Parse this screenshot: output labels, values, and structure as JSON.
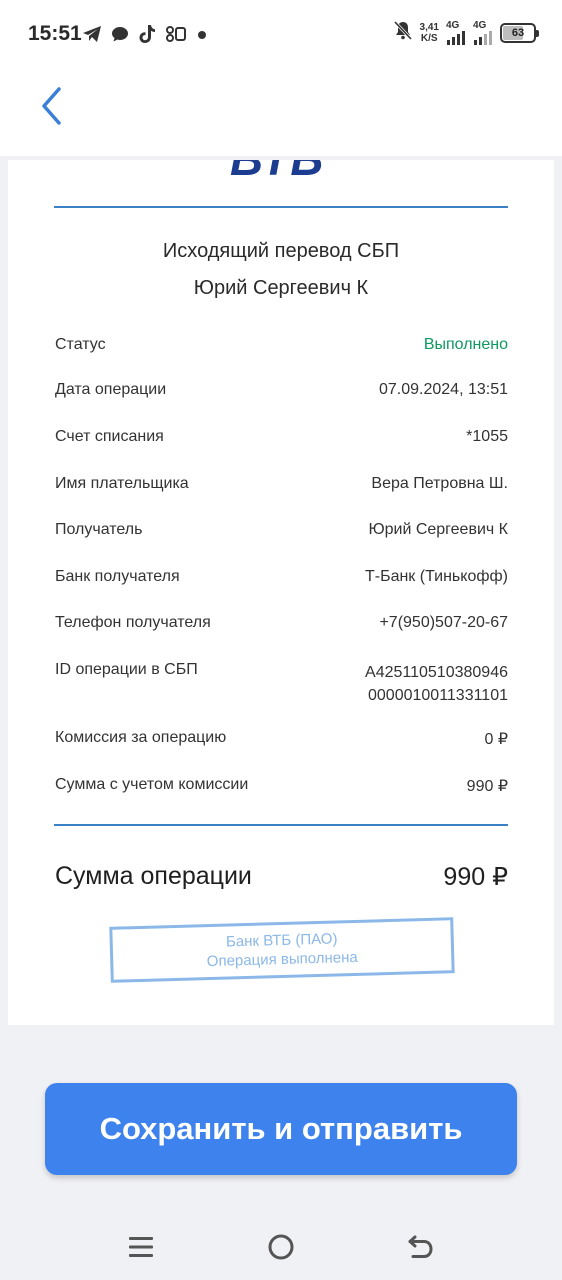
{
  "status_bar": {
    "time": "15:51",
    "speed_value": "3,41",
    "speed_unit": "K/S",
    "net1": "4G",
    "net2": "4G",
    "battery": "63"
  },
  "header": {
    "back_icon": "chevron-left-icon"
  },
  "receipt": {
    "bank_logo": "ВТБ",
    "title": "Исходящий перевод СБП",
    "recipient_name": "Юрий Сергеевич К",
    "rows": [
      {
        "label": "Статус",
        "value": "Выполнено"
      },
      {
        "label": "Дата операции",
        "value": "07.09.2024, 13:51"
      },
      {
        "label": "Счет списания",
        "value": "*1055"
      },
      {
        "label": "Имя плательщика",
        "value": "Вера Петровна Ш."
      },
      {
        "label": "Получатель",
        "value": "Юрий Сергеевич К"
      },
      {
        "label": "Банк получателя",
        "value": "Т-Банк (Тинькофф)"
      },
      {
        "label": "Телефон получателя",
        "value": "+7(950)507-20-67"
      },
      {
        "label": "ID операции в СБП",
        "value_line1": "A425110510380946",
        "value_line2": "0000010011331101"
      },
      {
        "label": "Комиссия за операцию",
        "value": "0 ₽"
      },
      {
        "label": "Сумма с учетом комиссии",
        "value": "990 ₽"
      }
    ],
    "total_label": "Сумма операции",
    "total_value": "990 ₽",
    "stamp_line1": "Банк ВТБ (ПАО)",
    "stamp_line2": "Операция выполнена"
  },
  "actions": {
    "save_label": "Сохранить и отправить"
  },
  "colors": {
    "accent": "#3d82ed",
    "status_success": "#0c9a60",
    "divider": "#3b82c4"
  }
}
